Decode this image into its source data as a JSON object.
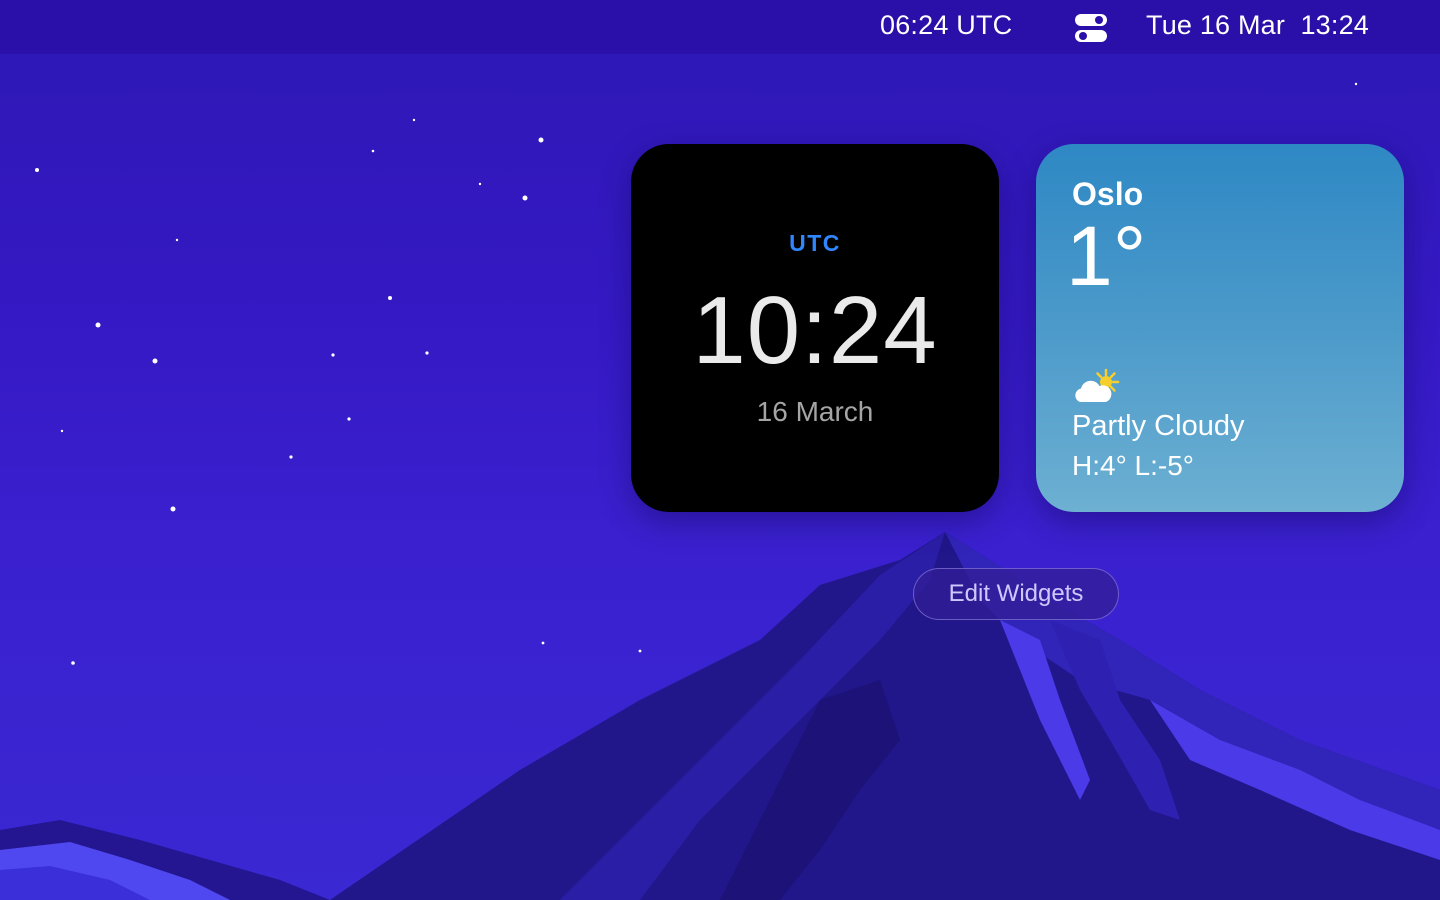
{
  "menubar": {
    "utc_clock": "06:24 UTC",
    "control_center_icon": "toggle-switch-icon",
    "datetime": "Tue 16 Mar  13:24"
  },
  "widgets": {
    "clock": {
      "timezone_label": "UTC",
      "time": "10:24",
      "date": "16 March",
      "accent_color": "#2f86ff"
    },
    "weather": {
      "city": "Oslo",
      "temperature": "1°",
      "condition_icon": "partly-cloudy-icon",
      "condition": "Partly Cloudy",
      "high_low": "H:4° L:-5°"
    }
  },
  "edit_widgets_button": {
    "label": "Edit Widgets"
  }
}
